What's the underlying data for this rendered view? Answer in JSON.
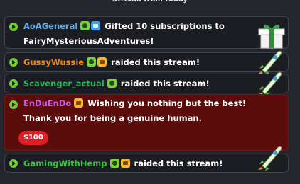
{
  "header": {
    "title": "Stream from today"
  },
  "colors": {
    "play": "#6fcf32",
    "donation_bg": "#5b0d0b",
    "amount_bg": "#e11c24"
  },
  "events": [
    {
      "user": "AoAGeneral",
      "user_color": "#5fb0e8",
      "badges": [
        "sub-badge-icon",
        "prime-badge-icon"
      ],
      "text": "Gifted 10 subscriptions to FairyMysteriousAdventures!",
      "icon": "gift-box-icon"
    },
    {
      "user": "GussyWussie",
      "user_color": "#f28a1e",
      "badges": [
        "sub-badge-icon",
        "tier-badge-icon"
      ],
      "text": "raided this stream!",
      "icon": "rocket-icon"
    },
    {
      "user": "Scavenger_actual",
      "user_color": "#26b25f",
      "badges": [
        "sub-badge-icon"
      ],
      "text": "raided this stream!",
      "icon": "rocket-icon"
    },
    {
      "user": "EnDuEnDo",
      "user_color": "#c95ce6",
      "badges": [
        "tier-badge-icon"
      ],
      "text": "Wishing you nothing but the best! Thank you for being a genuine human.",
      "amount": "$100"
    },
    {
      "user": "GamingWithHemp",
      "user_color": "#35c240",
      "badges": [
        "sub-badge-icon",
        "tier-badge-icon"
      ],
      "text": "raided this stream!",
      "icon": "rocket-icon"
    }
  ]
}
